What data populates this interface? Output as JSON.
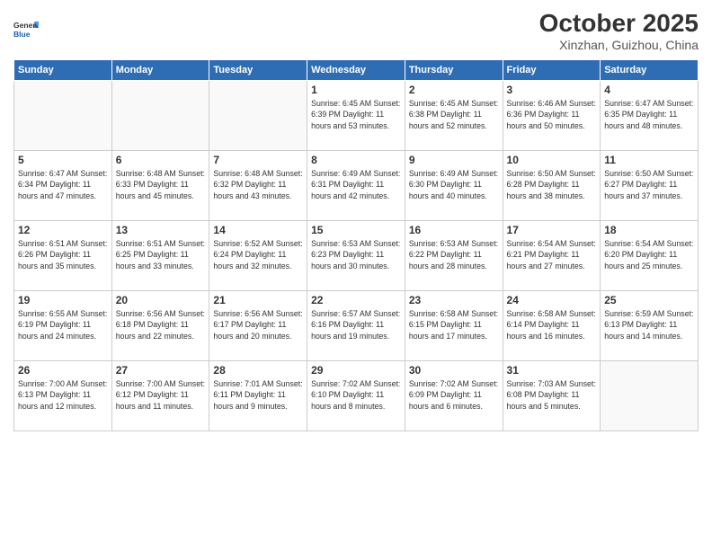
{
  "header": {
    "logo_general": "General",
    "logo_blue": "Blue",
    "month": "October 2025",
    "location": "Xinzhan, Guizhou, China"
  },
  "weekdays": [
    "Sunday",
    "Monday",
    "Tuesday",
    "Wednesday",
    "Thursday",
    "Friday",
    "Saturday"
  ],
  "weeks": [
    [
      {
        "day": "",
        "info": ""
      },
      {
        "day": "",
        "info": ""
      },
      {
        "day": "",
        "info": ""
      },
      {
        "day": "1",
        "info": "Sunrise: 6:45 AM\nSunset: 6:39 PM\nDaylight: 11 hours\nand 53 minutes."
      },
      {
        "day": "2",
        "info": "Sunrise: 6:45 AM\nSunset: 6:38 PM\nDaylight: 11 hours\nand 52 minutes."
      },
      {
        "day": "3",
        "info": "Sunrise: 6:46 AM\nSunset: 6:36 PM\nDaylight: 11 hours\nand 50 minutes."
      },
      {
        "day": "4",
        "info": "Sunrise: 6:47 AM\nSunset: 6:35 PM\nDaylight: 11 hours\nand 48 minutes."
      }
    ],
    [
      {
        "day": "5",
        "info": "Sunrise: 6:47 AM\nSunset: 6:34 PM\nDaylight: 11 hours\nand 47 minutes."
      },
      {
        "day": "6",
        "info": "Sunrise: 6:48 AM\nSunset: 6:33 PM\nDaylight: 11 hours\nand 45 minutes."
      },
      {
        "day": "7",
        "info": "Sunrise: 6:48 AM\nSunset: 6:32 PM\nDaylight: 11 hours\nand 43 minutes."
      },
      {
        "day": "8",
        "info": "Sunrise: 6:49 AM\nSunset: 6:31 PM\nDaylight: 11 hours\nand 42 minutes."
      },
      {
        "day": "9",
        "info": "Sunrise: 6:49 AM\nSunset: 6:30 PM\nDaylight: 11 hours\nand 40 minutes."
      },
      {
        "day": "10",
        "info": "Sunrise: 6:50 AM\nSunset: 6:28 PM\nDaylight: 11 hours\nand 38 minutes."
      },
      {
        "day": "11",
        "info": "Sunrise: 6:50 AM\nSunset: 6:27 PM\nDaylight: 11 hours\nand 37 minutes."
      }
    ],
    [
      {
        "day": "12",
        "info": "Sunrise: 6:51 AM\nSunset: 6:26 PM\nDaylight: 11 hours\nand 35 minutes."
      },
      {
        "day": "13",
        "info": "Sunrise: 6:51 AM\nSunset: 6:25 PM\nDaylight: 11 hours\nand 33 minutes."
      },
      {
        "day": "14",
        "info": "Sunrise: 6:52 AM\nSunset: 6:24 PM\nDaylight: 11 hours\nand 32 minutes."
      },
      {
        "day": "15",
        "info": "Sunrise: 6:53 AM\nSunset: 6:23 PM\nDaylight: 11 hours\nand 30 minutes."
      },
      {
        "day": "16",
        "info": "Sunrise: 6:53 AM\nSunset: 6:22 PM\nDaylight: 11 hours\nand 28 minutes."
      },
      {
        "day": "17",
        "info": "Sunrise: 6:54 AM\nSunset: 6:21 PM\nDaylight: 11 hours\nand 27 minutes."
      },
      {
        "day": "18",
        "info": "Sunrise: 6:54 AM\nSunset: 6:20 PM\nDaylight: 11 hours\nand 25 minutes."
      }
    ],
    [
      {
        "day": "19",
        "info": "Sunrise: 6:55 AM\nSunset: 6:19 PM\nDaylight: 11 hours\nand 24 minutes."
      },
      {
        "day": "20",
        "info": "Sunrise: 6:56 AM\nSunset: 6:18 PM\nDaylight: 11 hours\nand 22 minutes."
      },
      {
        "day": "21",
        "info": "Sunrise: 6:56 AM\nSunset: 6:17 PM\nDaylight: 11 hours\nand 20 minutes."
      },
      {
        "day": "22",
        "info": "Sunrise: 6:57 AM\nSunset: 6:16 PM\nDaylight: 11 hours\nand 19 minutes."
      },
      {
        "day": "23",
        "info": "Sunrise: 6:58 AM\nSunset: 6:15 PM\nDaylight: 11 hours\nand 17 minutes."
      },
      {
        "day": "24",
        "info": "Sunrise: 6:58 AM\nSunset: 6:14 PM\nDaylight: 11 hours\nand 16 minutes."
      },
      {
        "day": "25",
        "info": "Sunrise: 6:59 AM\nSunset: 6:13 PM\nDaylight: 11 hours\nand 14 minutes."
      }
    ],
    [
      {
        "day": "26",
        "info": "Sunrise: 7:00 AM\nSunset: 6:13 PM\nDaylight: 11 hours\nand 12 minutes."
      },
      {
        "day": "27",
        "info": "Sunrise: 7:00 AM\nSunset: 6:12 PM\nDaylight: 11 hours\nand 11 minutes."
      },
      {
        "day": "28",
        "info": "Sunrise: 7:01 AM\nSunset: 6:11 PM\nDaylight: 11 hours\nand 9 minutes."
      },
      {
        "day": "29",
        "info": "Sunrise: 7:02 AM\nSunset: 6:10 PM\nDaylight: 11 hours\nand 8 minutes."
      },
      {
        "day": "30",
        "info": "Sunrise: 7:02 AM\nSunset: 6:09 PM\nDaylight: 11 hours\nand 6 minutes."
      },
      {
        "day": "31",
        "info": "Sunrise: 7:03 AM\nSunset: 6:08 PM\nDaylight: 11 hours\nand 5 minutes."
      },
      {
        "day": "",
        "info": ""
      }
    ]
  ]
}
